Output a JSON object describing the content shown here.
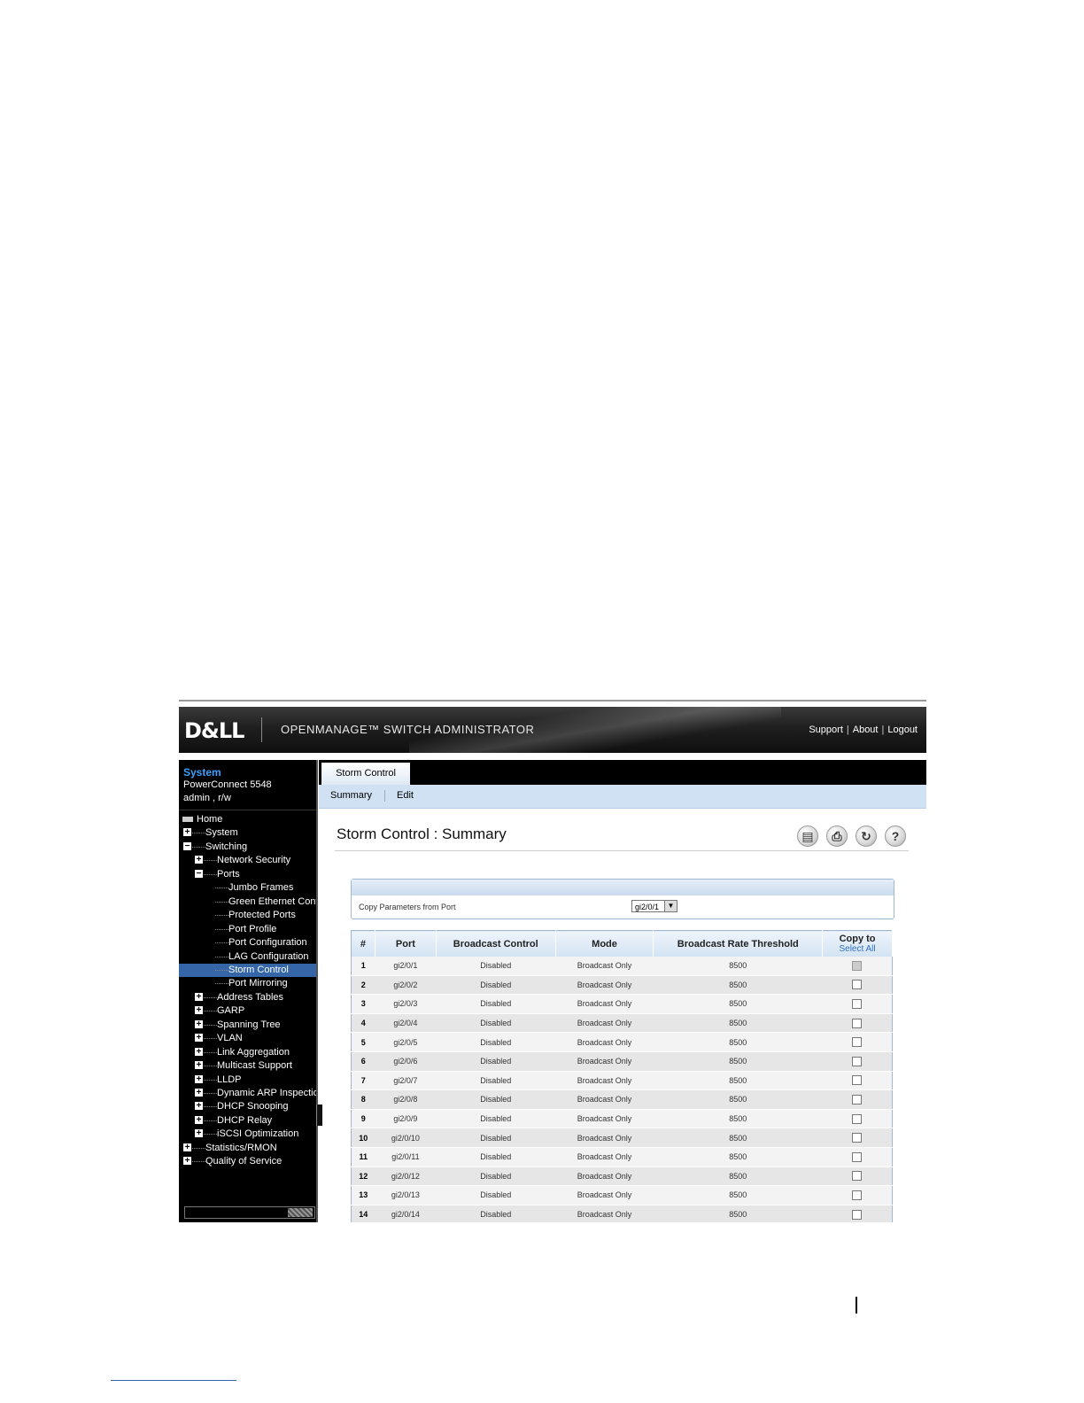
{
  "header": {
    "logo": "D&LL",
    "app_title": "OPENMANAGE™ SWITCH ADMINISTRATOR",
    "links": [
      "Support",
      "About",
      "Logout"
    ]
  },
  "system": {
    "title": "System",
    "model": "PowerConnect 5548",
    "user": "admin , r/w"
  },
  "tree": [
    {
      "label": "Home",
      "level": 0,
      "toggle": "home"
    },
    {
      "label": "System",
      "level": 0,
      "toggle": "+"
    },
    {
      "label": "Switching",
      "level": 0,
      "toggle": "-"
    },
    {
      "label": "Network Security",
      "level": 1,
      "toggle": "+"
    },
    {
      "label": "Ports",
      "level": 1,
      "toggle": "-"
    },
    {
      "label": "Jumbo Frames",
      "level": 2,
      "toggle": ""
    },
    {
      "label": "Green Ethernet Confi",
      "level": 2,
      "toggle": ""
    },
    {
      "label": "Protected Ports",
      "level": 2,
      "toggle": ""
    },
    {
      "label": "Port Profile",
      "level": 2,
      "toggle": ""
    },
    {
      "label": "Port Configuration",
      "level": 2,
      "toggle": ""
    },
    {
      "label": "LAG Configuration",
      "level": 2,
      "toggle": ""
    },
    {
      "label": "Storm Control",
      "level": 2,
      "toggle": "",
      "active": true
    },
    {
      "label": "Port Mirroring",
      "level": 2,
      "toggle": ""
    },
    {
      "label": "Address Tables",
      "level": 1,
      "toggle": "+"
    },
    {
      "label": "GARP",
      "level": 1,
      "toggle": "+"
    },
    {
      "label": "Spanning Tree",
      "level": 1,
      "toggle": "+"
    },
    {
      "label": "VLAN",
      "level": 1,
      "toggle": "+"
    },
    {
      "label": "Link Aggregation",
      "level": 1,
      "toggle": "+"
    },
    {
      "label": "Multicast Support",
      "level": 1,
      "toggle": "+"
    },
    {
      "label": "LLDP",
      "level": 1,
      "toggle": "+"
    },
    {
      "label": "Dynamic ARP Inspection",
      "level": 1,
      "toggle": "+"
    },
    {
      "label": "DHCP Snooping",
      "level": 1,
      "toggle": "+"
    },
    {
      "label": "DHCP Relay",
      "level": 1,
      "toggle": "+"
    },
    {
      "label": "iSCSI Optimization",
      "level": 1,
      "toggle": "+"
    },
    {
      "label": "Statistics/RMON",
      "level": 0,
      "toggle": "+"
    },
    {
      "label": "Quality of Service",
      "level": 0,
      "toggle": "+"
    }
  ],
  "tab": "Storm Control",
  "subtabs": [
    "Summary",
    "Edit"
  ],
  "page_title": "Storm Control : Summary",
  "tools": [
    "save-icon",
    "print-icon",
    "refresh-icon",
    "help-icon"
  ],
  "copy_params": {
    "label": "Copy Parameters from Port",
    "selected": "gi2/0/1"
  },
  "table": {
    "headers": [
      "#",
      "Port",
      "Broadcast Control",
      "Mode",
      "Broadcast Rate Threshold",
      "Copy to"
    ],
    "select_all": "Select All",
    "rows": [
      [
        "1",
        "gi2/0/1",
        "Disabled",
        "Broadcast Only",
        "8500"
      ],
      [
        "2",
        "gi2/0/2",
        "Disabled",
        "Broadcast Only",
        "8500"
      ],
      [
        "3",
        "gi2/0/3",
        "Disabled",
        "Broadcast Only",
        "8500"
      ],
      [
        "4",
        "gi2/0/4",
        "Disabled",
        "Broadcast Only",
        "8500"
      ],
      [
        "5",
        "gi2/0/5",
        "Disabled",
        "Broadcast Only",
        "8500"
      ],
      [
        "6",
        "gi2/0/6",
        "Disabled",
        "Broadcast Only",
        "8500"
      ],
      [
        "7",
        "gi2/0/7",
        "Disabled",
        "Broadcast Only",
        "8500"
      ],
      [
        "8",
        "gi2/0/8",
        "Disabled",
        "Broadcast Only",
        "8500"
      ],
      [
        "9",
        "gi2/0/9",
        "Disabled",
        "Broadcast Only",
        "8500"
      ],
      [
        "10",
        "gi2/0/10",
        "Disabled",
        "Broadcast Only",
        "8500"
      ],
      [
        "11",
        "gi2/0/11",
        "Disabled",
        "Broadcast Only",
        "8500"
      ],
      [
        "12",
        "gi2/0/12",
        "Disabled",
        "Broadcast Only",
        "8500"
      ],
      [
        "13",
        "gi2/0/13",
        "Disabled",
        "Broadcast Only",
        "8500"
      ],
      [
        "14",
        "gi2/0/14",
        "Disabled",
        "Broadcast Only",
        "8500"
      ]
    ]
  }
}
